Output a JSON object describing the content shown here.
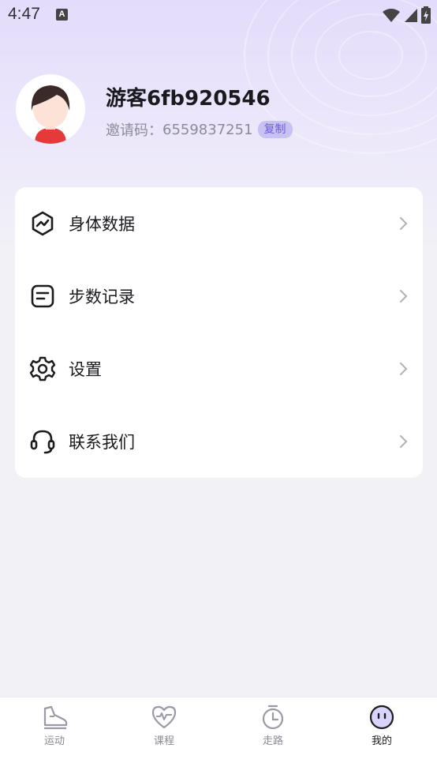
{
  "status_bar": {
    "time": "4:47",
    "icons": [
      "a-notification-icon",
      "wifi-icon",
      "signal-icon",
      "battery-icon"
    ]
  },
  "profile": {
    "username": "游客6fb920546",
    "invite_label": "邀请码：",
    "invite_code": "6559837251",
    "copy_label": "复制"
  },
  "menu": {
    "items": [
      {
        "label": "身体数据",
        "icon": "body-data-icon"
      },
      {
        "label": "步数记录",
        "icon": "step-record-icon"
      },
      {
        "label": "设置",
        "icon": "settings-gear-icon"
      },
      {
        "label": "联系我们",
        "icon": "headset-icon"
      }
    ]
  },
  "tabbar": {
    "tabs": [
      {
        "label": "运动",
        "icon": "sneaker-icon"
      },
      {
        "label": "课程",
        "icon": "heart-pulse-icon"
      },
      {
        "label": "走路",
        "icon": "stopwatch-icon"
      },
      {
        "label": "我的",
        "icon": "profile-face-icon"
      }
    ],
    "active_index": 3
  },
  "colors": {
    "accent": "#6a5fd6",
    "badge_bg": "#c8c2f2",
    "hero_top": "#e3dcfb",
    "background": "#f2f2f6"
  }
}
